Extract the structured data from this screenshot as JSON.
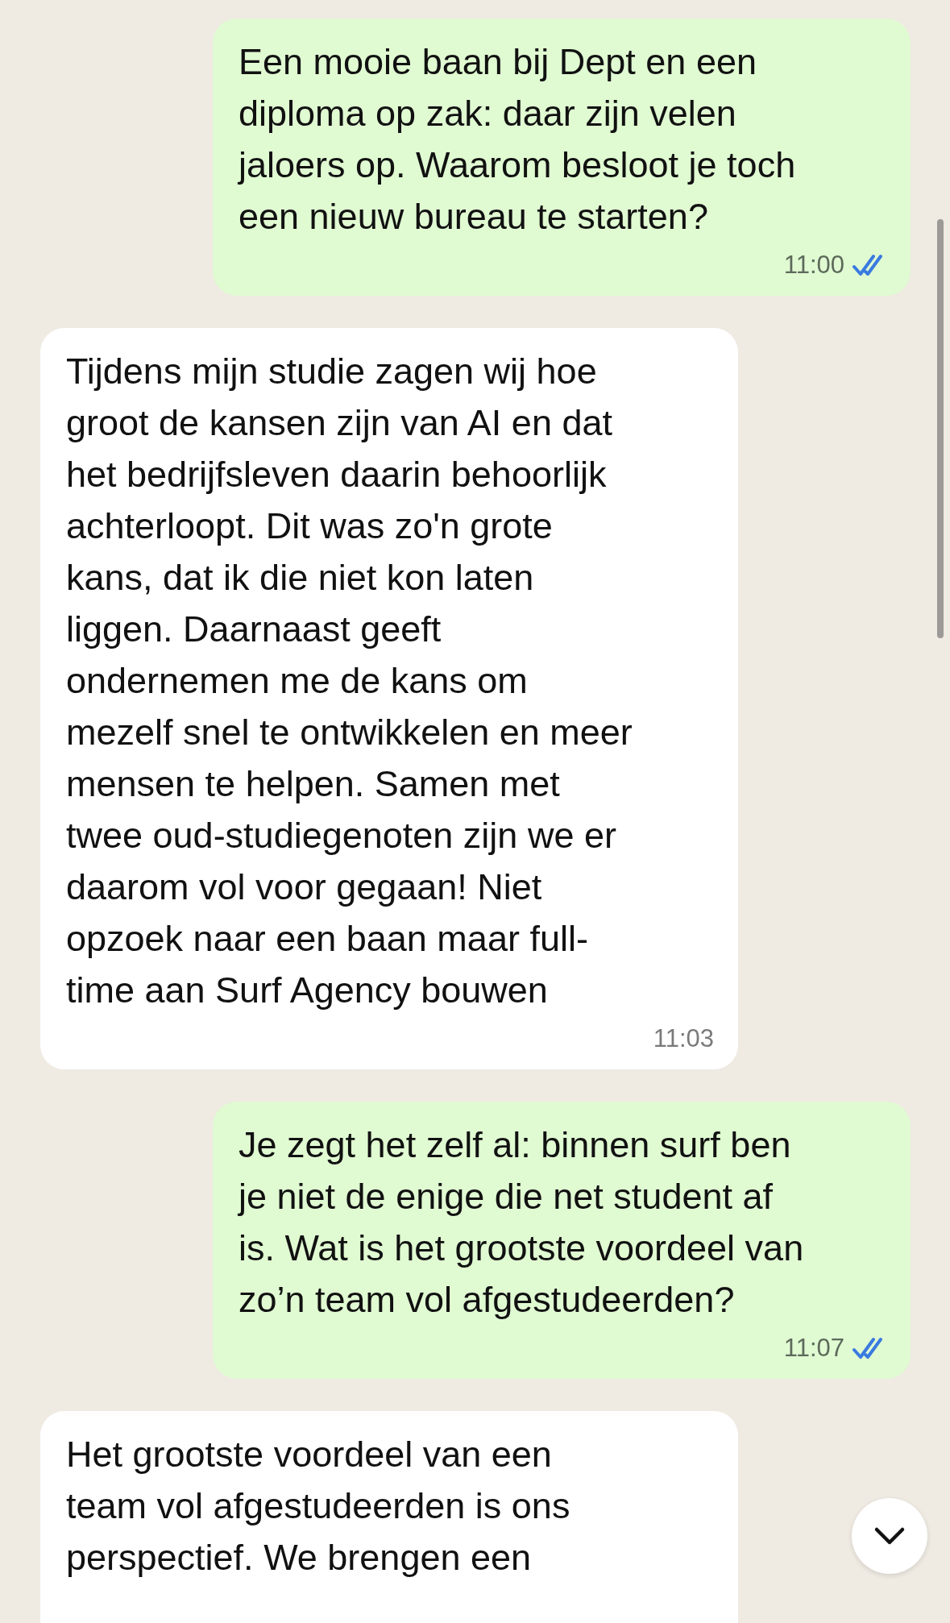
{
  "messages": [
    {
      "kind": "outgoing",
      "text": "Een mooie baan bij Dept en een\ndiploma op zak: daar zijn velen\njaloers op. Waarom besloot je toch\neen nieuw bureau te starten?",
      "time": "11:00",
      "read": true
    },
    {
      "kind": "incoming",
      "text": "Tijdens mijn studie zagen wij hoe\ngroot de kansen zijn van AI en dat\nhet bedrijfsleven daarin behoorlijk\nachterloopt. Dit was zo'n grote\nkans, dat ik die niet kon laten\nliggen. Daarnaast geeft\nondernemen me de kans om\nmezelf snel te ontwikkelen en meer\nmensen te helpen. Samen met\ntwee oud-studiegenoten zijn we er\ndaarom vol voor gegaan! Niet\nopzoek naar een baan maar full-\ntime aan Surf Agency bouwen",
      "time": "11:03"
    },
    {
      "kind": "outgoing",
      "text": "Je zegt het zelf al: binnen surf ben\nje niet de enige die net student af\nis. Wat is het grootste voordeel van\nzo’n team vol afgestudeerden?",
      "time": "11:07",
      "read": true
    },
    {
      "kind": "incoming",
      "text": "Het grootste voordeel van een\nteam vol afgestudeerden is ons\nperspectief. We brengen een"
    }
  ]
}
